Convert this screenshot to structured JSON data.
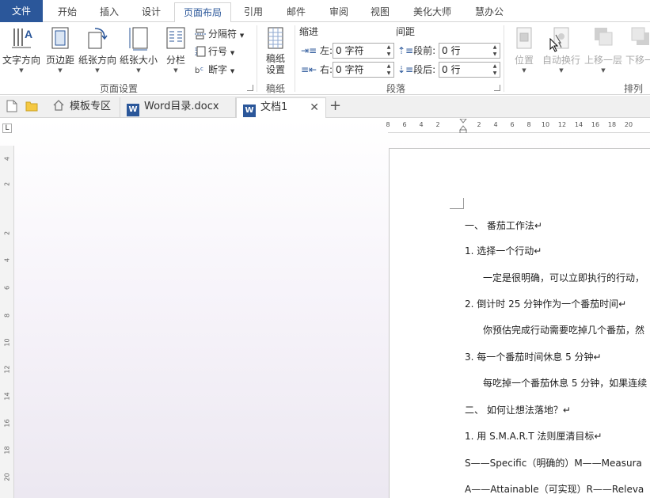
{
  "ribbon_tabs": [
    "文件",
    "开始",
    "插入",
    "设计",
    "页面布局",
    "引用",
    "邮件",
    "审阅",
    "视图",
    "美化大师",
    "慧办公"
  ],
  "page_setup": {
    "text_direction": "文字方向",
    "margins": "页边距",
    "orientation": "纸张方向",
    "size": "纸张大小",
    "columns": "分栏",
    "breaks": "分隔符",
    "line_numbers": "行号",
    "hyphenation": "断字",
    "group_label": "页面设置"
  },
  "manuscript": {
    "button": "稿纸\n设置",
    "group_label": "稿纸"
  },
  "paragraph": {
    "indent_title": "缩进",
    "spacing_title": "间距",
    "left_label": "左:",
    "right_label": "右:",
    "before_label": "段前:",
    "after_label": "段后:",
    "left_value": "0 字符",
    "right_value": "0 字符",
    "before_value": "0 行",
    "after_value": "0 行",
    "group_label": "段落"
  },
  "arrange": {
    "position": "位置",
    "wrap_text": "自动换行",
    "bring_forward": "上移一层",
    "send_backward": "下移一",
    "group_label": "排列"
  },
  "doc_tabs": [
    {
      "label": "模板专区"
    },
    {
      "label": "Word目录.docx"
    },
    {
      "label": "文档1"
    }
  ],
  "hruler_ticks": [
    "8",
    "6",
    "4",
    "2",
    "2",
    "4",
    "6",
    "8",
    "10",
    "12",
    "14",
    "16",
    "18",
    "20"
  ],
  "vruler_ticks": [
    "4",
    "2",
    "2",
    "4",
    "6",
    "8",
    "10",
    "12",
    "14",
    "16",
    "18",
    "20"
  ],
  "ruler_corner": "L",
  "document_lines": [
    "一、      番茄工作法↵",
    "1.   选择一个行动↵",
    "一定是很明确，可以立即执行的行动，",
    "2.   倒计时 25 分钟作为一个番茄时间↵",
    "你预估完成行动需要吃掉几个番茄，然",
    "3.   每一个番茄时间休息 5 分钟↵",
    "每吃掉一个番茄休息 5 分钟，如果连续",
    "二、      如何让想法落地？↵",
    "1.   用 S.M.A.R.T 法则厘清目标↵",
    "S——Specific（明确的）M——Measura",
    "A——Attainable（可实现）R——Releva"
  ]
}
